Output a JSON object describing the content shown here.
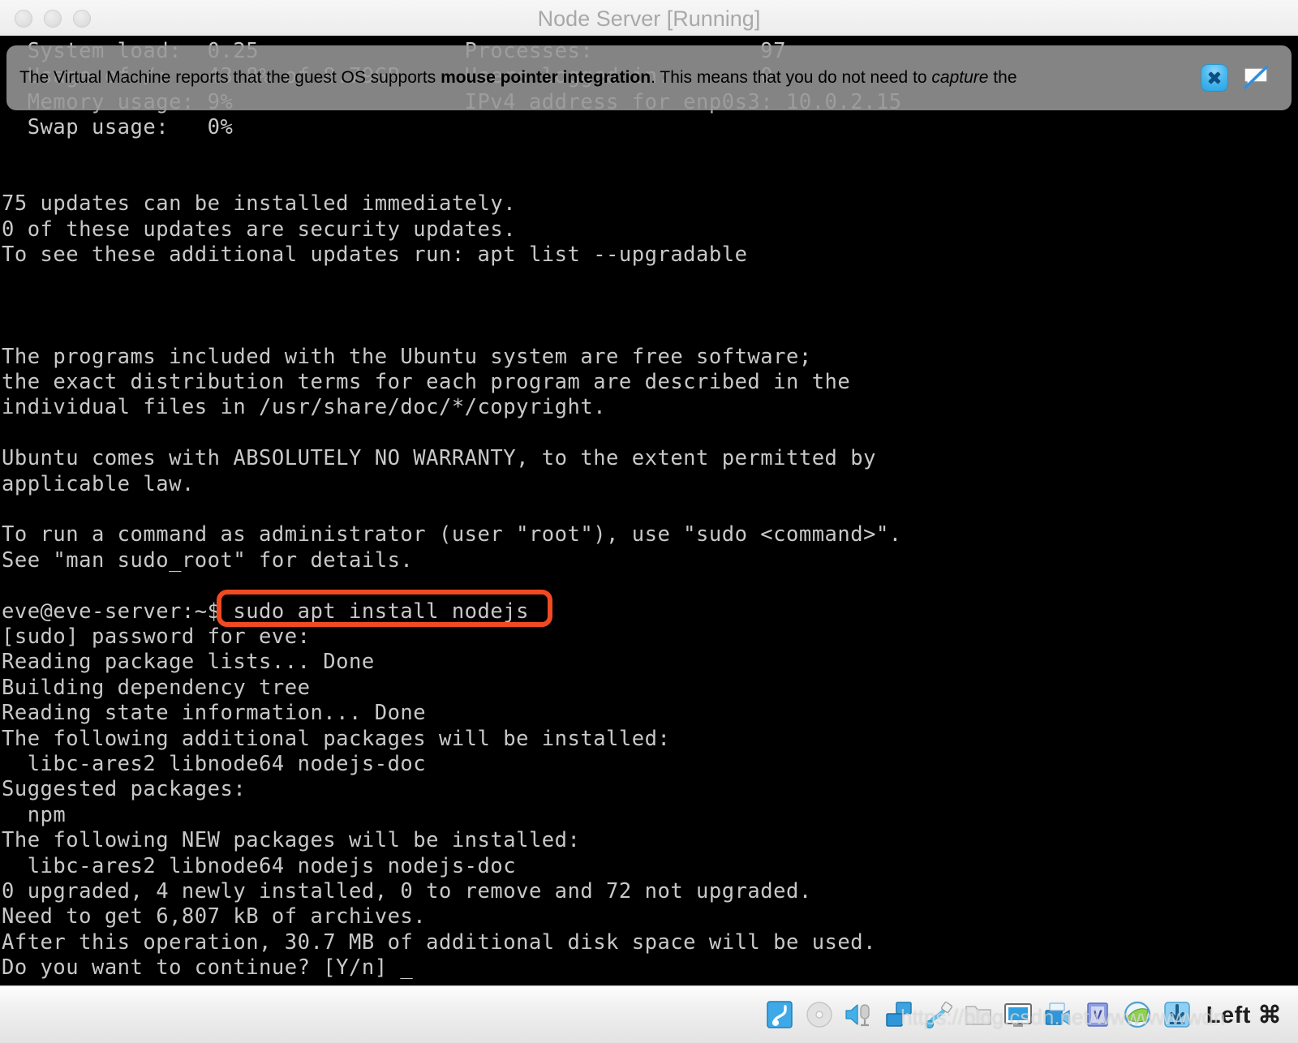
{
  "window": {
    "title": "Node Server [Running]",
    "traffic_lights": [
      "close",
      "minimize",
      "zoom"
    ]
  },
  "notification": {
    "text_parts": [
      {
        "text": "The Virtual Machine reports that the guest OS supports ",
        "style": "normal"
      },
      {
        "text": "mouse pointer integration",
        "style": "bold"
      },
      {
        "text": ". This means that you do not need to ",
        "style": "normal"
      },
      {
        "text": "capture",
        "style": "italic"
      },
      {
        "text": " the",
        "style": "normal"
      }
    ],
    "full_text": "The Virtual Machine reports that the guest OS supports mouse pointer integration. This means that you do not need to capture the",
    "close_icon": "close-icon",
    "mute_icon": "disable-notification-icon",
    "background_color": "#969696"
  },
  "terminal": {
    "foreground_color": "#c8c8c8",
    "background_color": "#000000",
    "lines": [
      "  System load:  0.25                Processes:             97",
      "  Usage of /:   43.8% of 8.79GB     Users logged in:       0",
      "  Memory usage: 9%                  IPv4 address for enp0s3: 10.0.2.15",
      "  Swap usage:   0%",
      "",
      "",
      "75 updates can be installed immediately.",
      "0 of these updates are security updates.",
      "To see these additional updates run: apt list --upgradable",
      "",
      "",
      "",
      "The programs included with the Ubuntu system are free software;",
      "the exact distribution terms for each program are described in the",
      "individual files in /usr/share/doc/*/copyright.",
      "",
      "Ubuntu comes with ABSOLUTELY NO WARRANTY, to the extent permitted by",
      "applicable law.",
      "",
      "To run a command as administrator (user \"root\"), use \"sudo <command>\".",
      "See \"man sudo_root\" for details.",
      "",
      "eve@eve-server:~$ sudo apt install nodejs",
      "[sudo] password for eve:",
      "Reading package lists... Done",
      "Building dependency tree",
      "Reading state information... Done",
      "The following additional packages will be installed:",
      "  libc-ares2 libnode64 nodejs-doc",
      "Suggested packages:",
      "  npm",
      "The following NEW packages will be installed:",
      "  libc-ares2 libnode64 nodejs nodejs-doc",
      "0 upgraded, 4 newly installed, 0 to remove and 72 not upgraded.",
      "Need to get 6,807 kB of archives.",
      "After this operation, 30.7 MB of additional disk space will be used.",
      "Do you want to continue? [Y/n] _"
    ]
  },
  "annotation": {
    "highlighted_command": "sudo apt install nodejs",
    "box_color": "#f04a23"
  },
  "statusbar": {
    "icons": [
      "hard-disk-icon",
      "optical-disk-icon",
      "audio-icon",
      "network-icon",
      "usb-icon",
      "shared-folder-icon",
      "display-icon",
      "video-capture-icon",
      "virtualization-icon",
      "mouse-icon",
      "keyboard-icon"
    ],
    "host_key_label": "Left ⌘"
  },
  "watermark": {
    "text": "https://blog.csdn.net/wwwwwwwdn"
  }
}
